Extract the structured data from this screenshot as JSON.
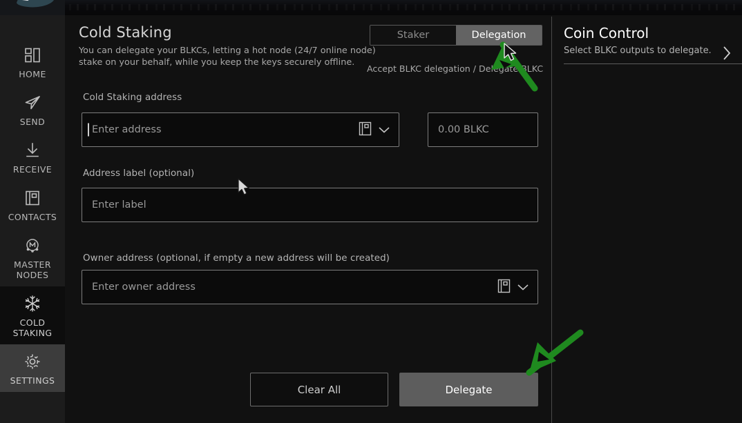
{
  "app": {
    "logo": "blkc-logo"
  },
  "sidebar": {
    "items": [
      {
        "label": "HOME",
        "icon": "dashboard-icon",
        "state": "normal"
      },
      {
        "label": "SEND",
        "icon": "send-plane-icon",
        "state": "normal"
      },
      {
        "label": "RECEIVE",
        "icon": "download-icon",
        "state": "normal"
      },
      {
        "label": "CONTACTS",
        "icon": "address-book-icon",
        "state": "normal"
      },
      {
        "label": "MASTER\nNODES",
        "icon": "masternode-icon",
        "state": "normal"
      },
      {
        "label": "COLD\nSTAKING",
        "icon": "snowflake-icon",
        "state": "active"
      },
      {
        "label": "SETTINGS",
        "icon": "gear-icon",
        "state": "hover"
      }
    ]
  },
  "main": {
    "title": "Cold Staking",
    "description": "You can delegate your BLKCs, letting a hot node (24/7 online node) stake on your behalf, while you keep the keys securely offline.",
    "toggle": {
      "staker_label": "Staker",
      "delegation_label": "Delegation",
      "selected": "Delegation",
      "note": "Accept BLKC delegation / Delegate BLKC"
    },
    "fields": {
      "cold_staking_address": {
        "label": "Cold Staking address",
        "placeholder": "Enter address",
        "value": "",
        "focused": true
      },
      "amount": {
        "placeholder": "0.00 BLKC",
        "value": ""
      },
      "address_label": {
        "label": "Address label (optional)",
        "placeholder": "Enter label",
        "value": ""
      },
      "owner_address": {
        "label": "Owner address (optional, if empty a new address will be created)",
        "placeholder": "Enter owner address",
        "value": ""
      }
    },
    "buttons": {
      "clear_all": "Clear All",
      "delegate": "Delegate"
    }
  },
  "coin_control": {
    "title": "Coin Control",
    "subtitle": "Select BLKC outputs to delegate.",
    "chevron": "chevron-right-icon"
  },
  "colors": {
    "accent_green": "#1f8a1f",
    "panel_bg": "#111111",
    "sidebar_bg": "#1c1c1c",
    "active_item_bg": "#0d0d0d",
    "hover_item_bg": "#3c3c3c",
    "primary_button_bg": "#5d5d5d",
    "border": "#7d7d7d",
    "text_primary": "#d6d6d6",
    "text_muted": "#9a9a9a"
  },
  "annotations": [
    {
      "name": "green-arrow-to-delegation-toggle",
      "points_to": "Delegation"
    },
    {
      "name": "green-arrow-to-delegate-button",
      "points_to": "Delegate"
    }
  ]
}
